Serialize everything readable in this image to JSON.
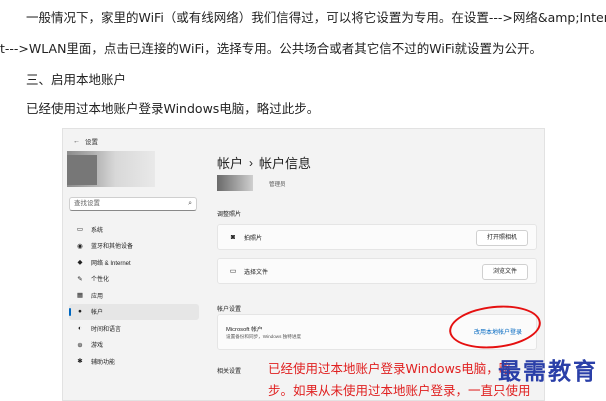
{
  "article": {
    "p1": "一般情况下，家里的WiFi（或有线网络）我们信得过，可以将它设置为专用。在设置--->网络&amp;Interne",
    "p2": "t--->WLAN里面，点击已连接的WiFi，选择专用。公共场合或者其它信不过的WiFi就设置为公开。",
    "h3": "三、启用本地账户",
    "p4": "已经使用过本地账户登录Windows电脑，略过此步。"
  },
  "screenshot": {
    "window_title": "设置",
    "search_placeholder": "查找设置",
    "nav": [
      {
        "label": "系统",
        "icon": "monitor-icon",
        "glyph": "▭"
      },
      {
        "label": "蓝牙和其他设备",
        "icon": "bluetooth-icon",
        "glyph": "◉"
      },
      {
        "label": "网络 & Internet",
        "icon": "wifi-icon",
        "glyph": "◆"
      },
      {
        "label": "个性化",
        "icon": "brush-icon",
        "glyph": "✎"
      },
      {
        "label": "应用",
        "icon": "apps-icon",
        "glyph": "▦"
      },
      {
        "label": "帐户",
        "icon": "person-icon",
        "glyph": "●",
        "active": true
      },
      {
        "label": "时间和语言",
        "icon": "clock-icon",
        "glyph": "◐"
      },
      {
        "label": "游戏",
        "icon": "gamepad-icon",
        "glyph": "⊕"
      },
      {
        "label": "辅助功能",
        "icon": "accessibility-icon",
        "glyph": "✱"
      }
    ],
    "breadcrumb_parent": "帐户",
    "breadcrumb_sep": "›",
    "breadcrumb_current": "帐户信息",
    "role": "管理员",
    "adjust_photo_label": "调整照片",
    "take_photo_label": "拍照片",
    "open_camera_button": "打开照相机",
    "choose_file_label": "选择文件",
    "browse_files_button": "浏览文件",
    "account_settings_label": "帐户设置",
    "ms_account_title": "Microsoft 帐户",
    "ms_account_desc": "设置备份和同步，Windows 独特进度",
    "switch_local_link": "改用本地帐户登录",
    "related_label": "相关设置"
  },
  "annotation": {
    "line1": "已经使用过本地账户登录Windows电脑，略",
    "line2": "步。如果从未使用过本地账户登录，一直只使用"
  },
  "watermark": "最需教育"
}
